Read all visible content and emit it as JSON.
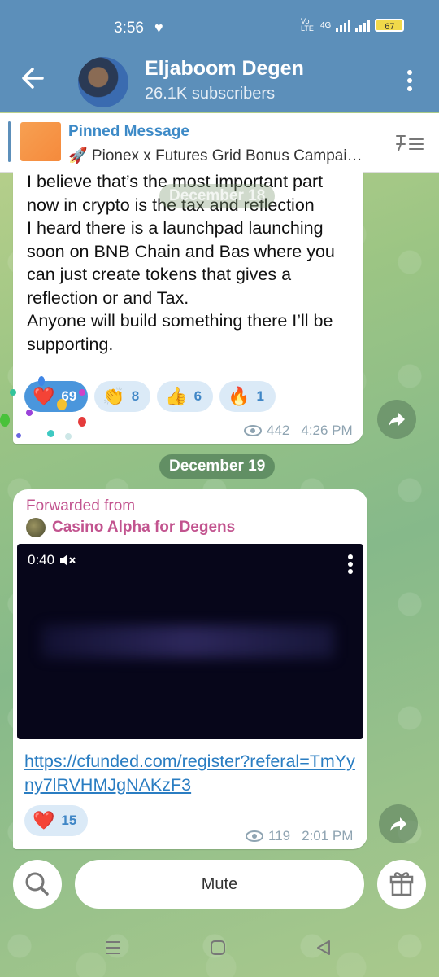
{
  "status_bar": {
    "time": "3:56",
    "battery": "67",
    "network": "4G",
    "volte": "Vo LTE"
  },
  "header": {
    "title": "Eljaboom Degen",
    "subtitle": "26.1K subscribers"
  },
  "pinned": {
    "title": "Pinned Message",
    "text": "🚀 Pionex x Futures Grid Bonus Campai…"
  },
  "messages": [
    {
      "text": "I believe that’s the most important part now in crypto is the tax and reflection\nI heard there is a launchpad launching soon on BNB Chain and Bas where you can just create tokens that gives a reflection or and Tax.\nAnyone will build something there I’ll be supporting.",
      "overlay_date": "December 18",
      "reactions": [
        {
          "emoji": "❤️",
          "count": "69",
          "active": true
        },
        {
          "emoji": "👏",
          "count": "8",
          "active": false
        },
        {
          "emoji": "👍",
          "count": "6",
          "active": false
        },
        {
          "emoji": "🔥",
          "count": "1",
          "active": false
        }
      ],
      "views": "442",
      "time": "4:26 PM"
    },
    {
      "date_separator": "December 19",
      "forwarded_label": "Forwarded from",
      "forwarded_source": "Casino Alpha for Degens",
      "video_time": "0:40",
      "link": "https://cfunded.com/register?referal=TmYyny7lRVHMJgNAKzF3",
      "reactions": [
        {
          "emoji": "❤️",
          "count": "15",
          "active": false
        }
      ],
      "views": "119",
      "time": "2:01 PM"
    }
  ],
  "bottom": {
    "mute_label": "Mute"
  },
  "colors": {
    "header": "#5c8fba",
    "accent": "#3d8ac7",
    "forward": "#c2548f"
  }
}
